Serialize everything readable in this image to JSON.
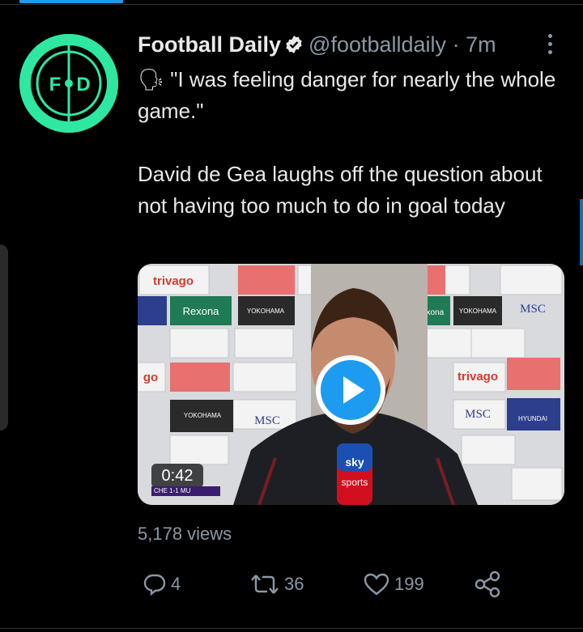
{
  "tweet": {
    "author_name": "Football Daily",
    "handle": "@footballdaily",
    "separator": "·",
    "time": "7m",
    "avatar_text": "F•D",
    "line1": "🗣 \"I was feeling danger for nearly the whole game.\"",
    "line2": "David de Gea laughs off the question about not having too much to do in goal today",
    "video_duration": "0:42",
    "scoreline": "CHE 1-1 MU",
    "views": "5,178 views",
    "replies": "4",
    "retweets": "36",
    "likes": "199"
  },
  "colors": {
    "accent": "#1d9bf0",
    "avatar_green": "#2ee8a1",
    "muted": "#8b98a5"
  },
  "icons": [
    "verified-icon",
    "more-icon",
    "play-icon",
    "reply-icon",
    "retweet-icon",
    "like-icon",
    "share-icon"
  ]
}
